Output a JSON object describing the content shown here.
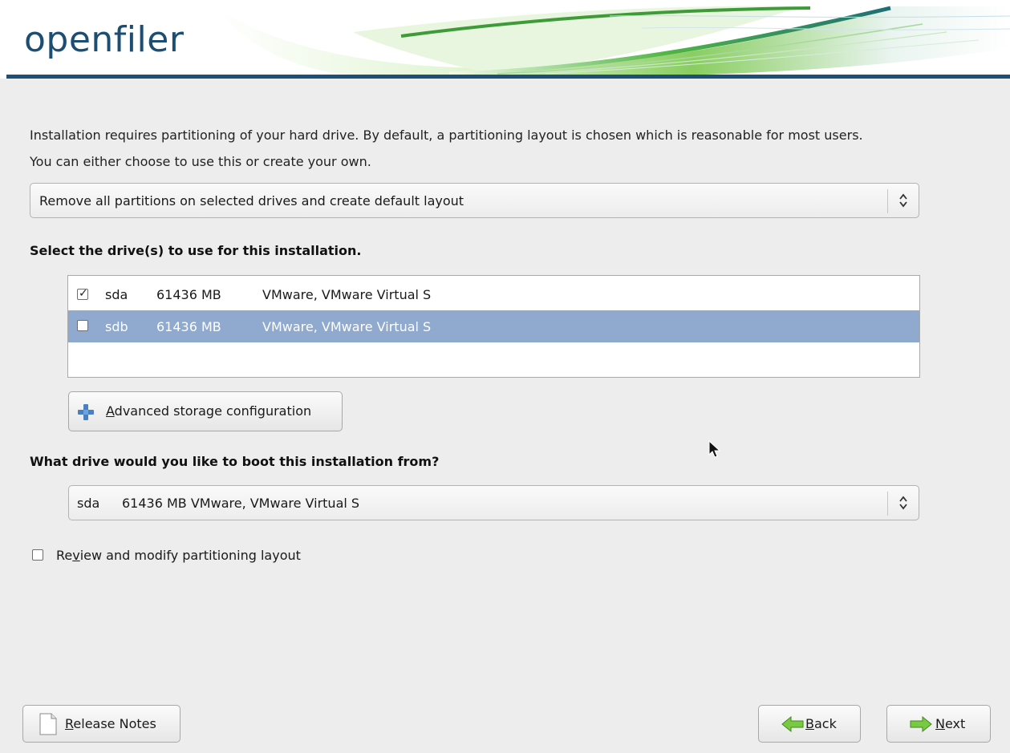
{
  "header": {
    "logo": "openfiler"
  },
  "intro": {
    "line1": "Installation requires partitioning of your hard drive.  By default, a partitioning layout is chosen which is reasonable for most users.",
    "line2": "You can either choose to use this or create your own."
  },
  "layout_select": {
    "value": "Remove all partitions on selected drives and create default layout"
  },
  "drives_heading": "Select the drive(s) to use for this installation.",
  "drives": [
    {
      "name": "sda",
      "size": "61436 MB",
      "model": "VMware, VMware Virtual S",
      "checked": true,
      "selected": false
    },
    {
      "name": "sdb",
      "size": "61436 MB",
      "model": "VMware, VMware Virtual S",
      "checked": false,
      "selected": true
    }
  ],
  "advanced_button": {
    "label_rest": "dvanced storage configuration",
    "mnemonic": "A",
    "icon": "plus-icon"
  },
  "boot_heading": "What drive would you like to boot this installation from?",
  "boot_select": {
    "name": "sda",
    "desc": "61436 MB VMware, VMware Virtual S"
  },
  "review_checkbox": {
    "label_pre": "Re",
    "mnemonic": "v",
    "label_post": "iew and modify partitioning layout",
    "checked": false
  },
  "footer": {
    "release_notes": {
      "mnemonic": "R",
      "rest": "elease Notes",
      "icon": "document-icon"
    },
    "back": {
      "mnemonic": "B",
      "rest": "ack",
      "icon": "arrow-left-icon"
    },
    "next": {
      "mnemonic": "N",
      "rest": "ext",
      "icon": "arrow-right-icon"
    }
  },
  "colors": {
    "brand": "#1c4e74",
    "header_rule": "#1e4f77",
    "selection": "#8fa9cf",
    "background": "#ededed"
  }
}
